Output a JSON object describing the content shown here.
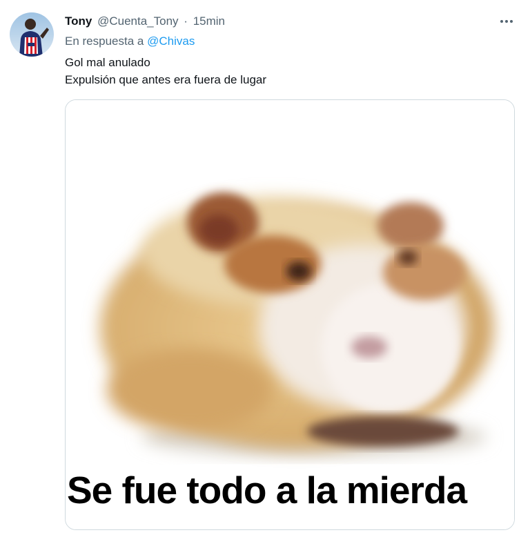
{
  "tweet": {
    "display_name": "Tony",
    "handle": "@Cuenta_Tony",
    "separator": "·",
    "time": "15min",
    "reply_prefix": "En respuesta a",
    "reply_mention": "@Chivas",
    "lines": [
      "Gol mal anulado",
      "Expulsión que antes era fuera de lugar"
    ],
    "more_label": "···",
    "avatar_icon": "user-avatar-icon",
    "media": {
      "caption": "Se fue todo a la mierda",
      "subject_icon": "guinea-pig-image"
    }
  },
  "colors": {
    "text_primary": "#0f1419",
    "text_secondary": "#536471",
    "link": "#1d9bf0",
    "border": "#cfd9de"
  }
}
